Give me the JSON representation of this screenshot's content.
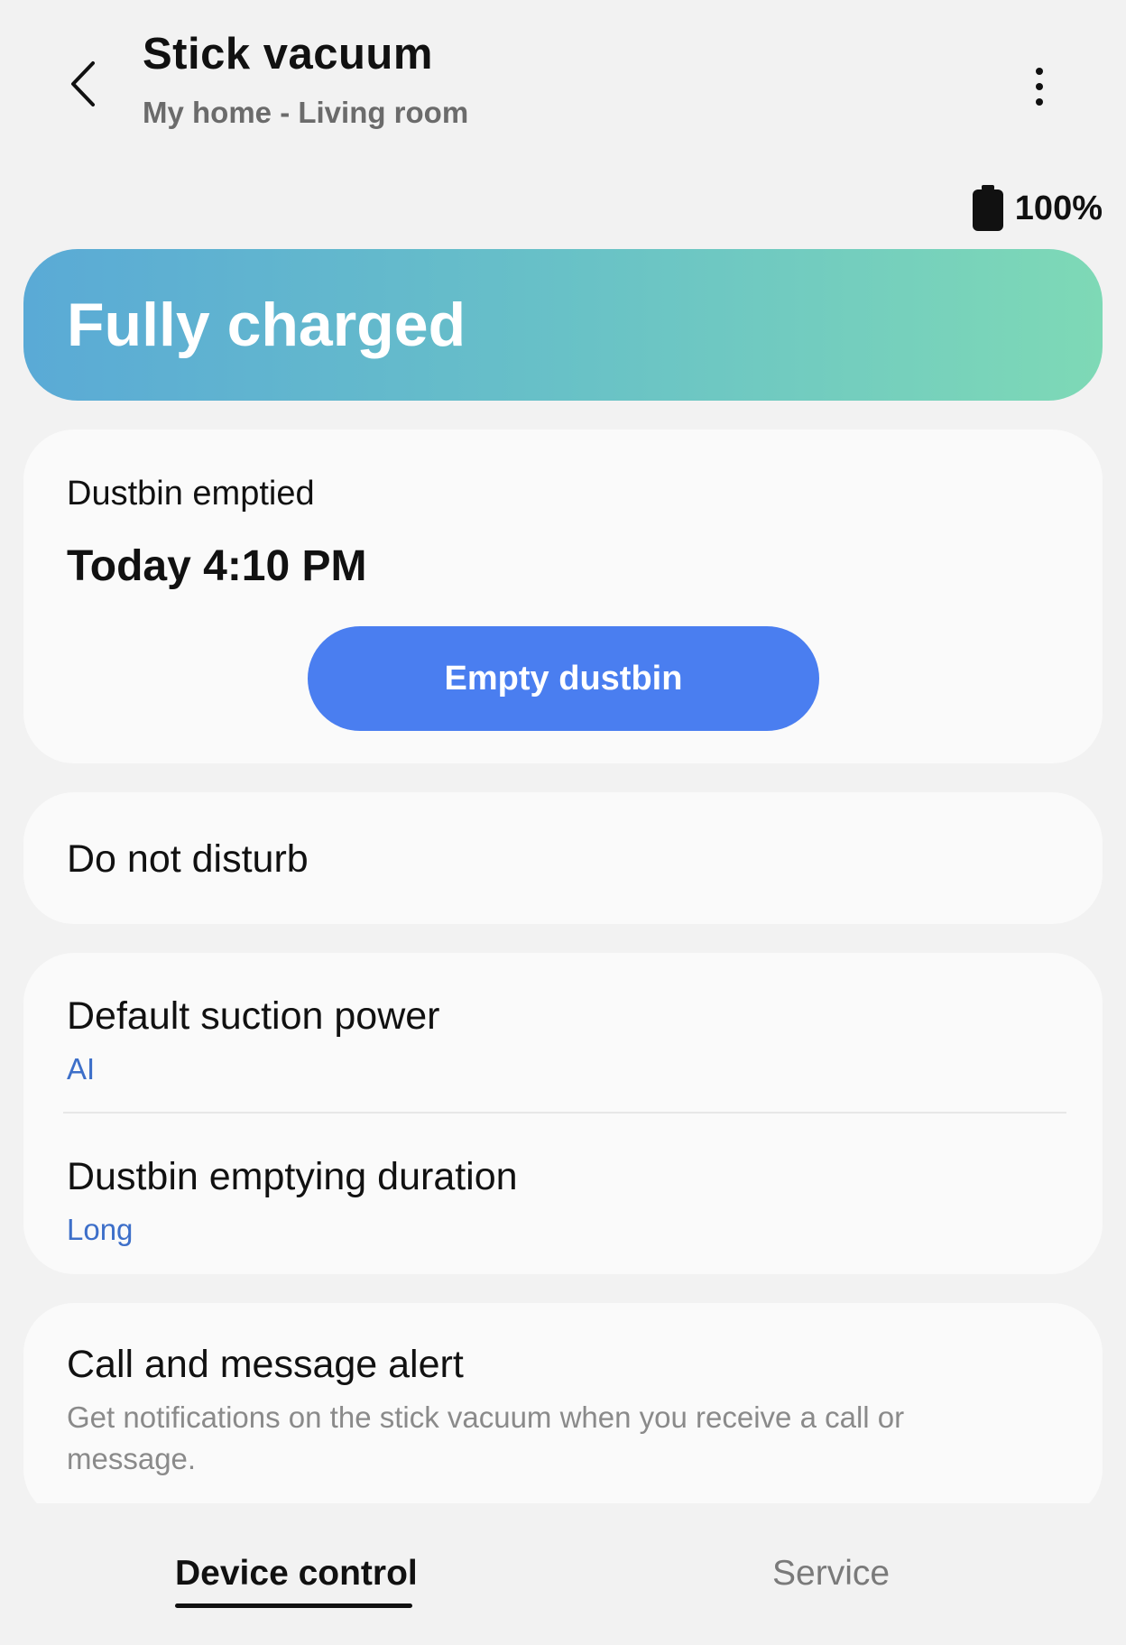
{
  "header": {
    "title": "Stick vacuum",
    "subtitle": "My home - Living room",
    "back_icon": "chevron-left-icon",
    "more_icon": "more-vertical-icon"
  },
  "battery": {
    "icon": "battery-full-icon",
    "level_text": "100%",
    "level_fraction": 1.0
  },
  "status": {
    "text": "Fully charged",
    "gradient_colors": [
      "#5aaad6",
      "#7ed9b6"
    ]
  },
  "dustbin": {
    "label": "Dustbin emptied",
    "time": "Today 4:10 PM",
    "button_label": "Empty dustbin",
    "button_color": "#4a7ef0"
  },
  "do_not_disturb": {
    "label": "Do not disturb"
  },
  "settings": {
    "suction": {
      "label": "Default suction power",
      "value": "AI"
    },
    "duration": {
      "label": "Dustbin emptying duration",
      "value": "Long"
    },
    "value_color": "#3d6fc9"
  },
  "alert": {
    "label": "Call and message alert",
    "description": "Get notifications on the stick vacuum when you receive a call or message."
  },
  "bottom_nav": {
    "tabs": [
      {
        "label": "Device control",
        "active": true
      },
      {
        "label": "Service",
        "active": false
      }
    ]
  }
}
